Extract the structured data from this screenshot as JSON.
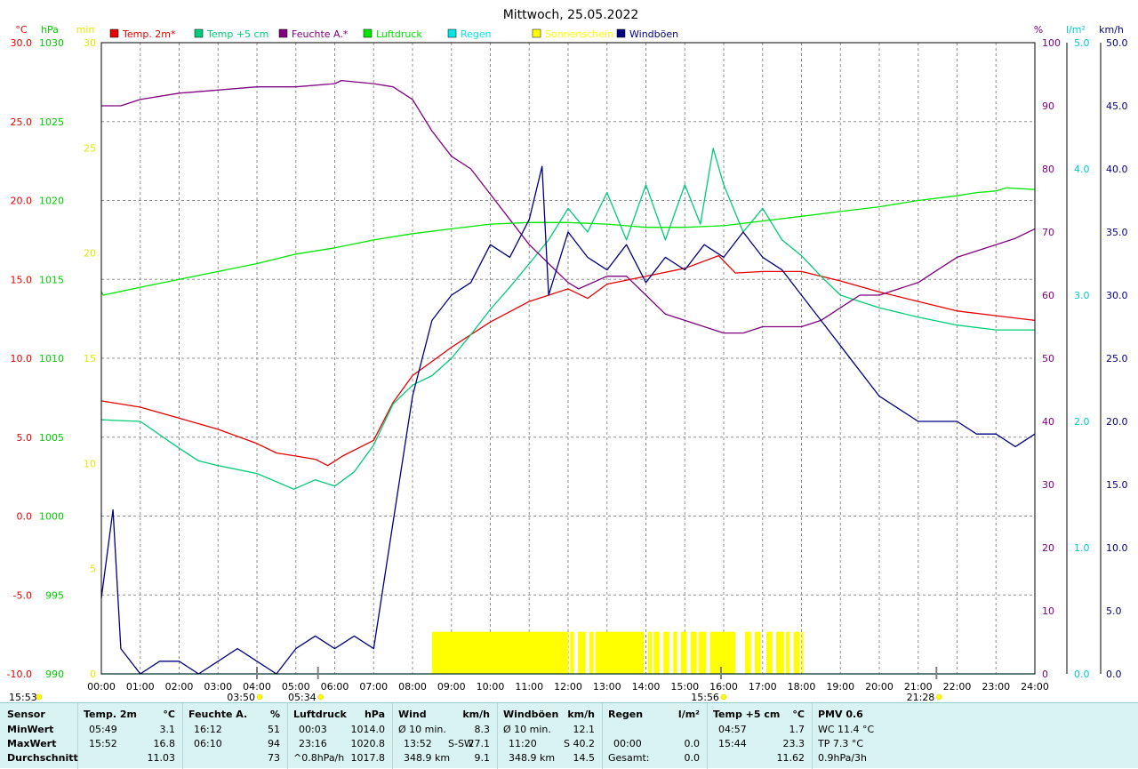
{
  "title": "Mittwoch, 25.05.2022",
  "colors": {
    "temp2m": "#e60000",
    "temp5cm": "#00cc77",
    "humidity": "#800080",
    "pressure": "#00e600",
    "rain": "#00e6e6",
    "sunshine": "#ffff00",
    "gusts": "#000080",
    "grid": "#808080"
  },
  "legend": [
    {
      "label": "Temp. 2m*",
      "color": "#e60000"
    },
    {
      "label": "Temp +5 cm",
      "color": "#00cc77"
    },
    {
      "label": "Feuchte A.*",
      "color": "#800080"
    },
    {
      "label": "Luftdruck",
      "color": "#00e600"
    },
    {
      "label": "Regen",
      "color": "#00e6e6"
    },
    {
      "label": "Sonnenschein",
      "color": "#ffff00"
    },
    {
      "label": "Windböen",
      "color": "#000080"
    }
  ],
  "axis_units": {
    "temp": "°C",
    "pressure": "hPa",
    "sun": "min",
    "humidity": "%",
    "rain": "l/m²",
    "wind": "km/h"
  },
  "chart_data": {
    "type": "line",
    "title": "Mittwoch, 25.05.2022",
    "x_ticks": [
      "00:00",
      "01:00",
      "02:00",
      "03:00",
      "04:00",
      "05:00",
      "06:00",
      "07:00",
      "08:00",
      "09:00",
      "10:00",
      "11:00",
      "12:00",
      "13:00",
      "14:00",
      "15:00",
      "16:00",
      "17:00",
      "18:00",
      "19:00",
      "20:00",
      "21:00",
      "22:00",
      "23:00",
      "24:00"
    ],
    "x_range_hours": [
      0,
      24
    ],
    "axes": {
      "temp_c": {
        "range": [
          -10,
          30
        ],
        "ticks": [
          "30.0",
          "25.0",
          "20.0",
          "15.0",
          "10.0",
          "5.0",
          "0.0",
          "-5.0",
          "-10.0"
        ]
      },
      "pressure_hpa": {
        "range": [
          990,
          1030
        ],
        "ticks": [
          "1030",
          "1025",
          "1020",
          "1015",
          "1010",
          "1005",
          "1000",
          "995",
          "990"
        ]
      },
      "sunshine_min": {
        "range": [
          0,
          30
        ],
        "ticks": [
          "30",
          "25",
          "20",
          "15",
          "10",
          "5",
          "0"
        ]
      },
      "humidity_pct": {
        "range": [
          0,
          100
        ],
        "ticks": [
          "100",
          "90",
          "80",
          "70",
          "60",
          "50",
          "40",
          "30",
          "20",
          "10",
          "0"
        ]
      },
      "rain_l": {
        "range": [
          0,
          5
        ],
        "ticks": [
          "5.0",
          "4.0",
          "3.0",
          "2.0",
          "1.0",
          "0.0"
        ]
      },
      "wind_kmh": {
        "range": [
          0,
          50
        ],
        "ticks": [
          "50.0",
          "45.0",
          "40.0",
          "35.0",
          "30.0",
          "25.0",
          "20.0",
          "15.0",
          "10.0",
          "5.0",
          "0.0"
        ]
      }
    },
    "grid": true,
    "legend_position": "top",
    "series": [
      {
        "name": "Temp. 2m*",
        "unit": "°C",
        "x": [
          0,
          1,
          2,
          3,
          4,
          4.5,
          5,
          5.5,
          5.82,
          6.2,
          7,
          7.5,
          8,
          9,
          10,
          11,
          12,
          12.5,
          13,
          14,
          15,
          15.87,
          16.3,
          17,
          18,
          19,
          20,
          21,
          22,
          23,
          24
        ],
        "y": [
          7.3,
          6.9,
          6.2,
          5.5,
          4.6,
          4.0,
          3.8,
          3.6,
          3.2,
          3.8,
          4.8,
          7.2,
          8.9,
          10.7,
          12.3,
          13.6,
          14.4,
          13.8,
          14.7,
          15.2,
          15.7,
          16.5,
          15.4,
          15.5,
          15.5,
          14.9,
          14.2,
          13.6,
          13.0,
          12.7,
          12.4
        ]
      },
      {
        "name": "Temp +5 cm",
        "unit": "°C",
        "x": [
          0,
          1,
          2,
          2.5,
          3,
          4,
          4.95,
          5.5,
          6,
          6.5,
          7,
          7.5,
          8,
          8.5,
          9,
          9.5,
          10,
          10.5,
          11,
          11.5,
          12,
          12.5,
          13,
          13.5,
          14,
          14.5,
          15,
          15.4,
          15.73,
          16,
          16.5,
          17,
          17.5,
          18,
          18.5,
          19,
          20,
          21,
          22,
          23,
          24
        ],
        "y": [
          6.1,
          6.0,
          4.3,
          3.5,
          3.2,
          2.7,
          1.7,
          2.3,
          1.9,
          2.8,
          4.5,
          7.1,
          8.3,
          8.9,
          10.0,
          11.5,
          13.1,
          14.5,
          16.0,
          17.5,
          19.5,
          18.0,
          20.5,
          17.5,
          21.0,
          17.5,
          21.0,
          18.5,
          23.3,
          21.0,
          18.0,
          19.5,
          17.5,
          16.5,
          15.2,
          14.0,
          13.2,
          12.6,
          12.1,
          11.8,
          11.8
        ]
      },
      {
        "name": "Feuchte A.*",
        "unit": "%",
        "x": [
          0,
          0.5,
          1,
          2,
          3,
          4,
          5,
          6,
          6.17,
          7,
          7.5,
          8,
          8.5,
          9,
          9.5,
          10,
          10.5,
          11,
          11.5,
          12,
          12.27,
          13,
          13.5,
          14,
          14.5,
          15,
          15.5,
          16,
          16.5,
          17,
          17.5,
          18,
          18.5,
          19,
          19.5,
          20,
          20.5,
          21,
          21.5,
          22,
          23,
          23.5,
          24
        ],
        "y": [
          90,
          90,
          91,
          92,
          92.5,
          93,
          93,
          93.5,
          94,
          93.5,
          93,
          91,
          86,
          82,
          80,
          76,
          72,
          68,
          65,
          62,
          61,
          63,
          63,
          60,
          57,
          56,
          55,
          54,
          54,
          55,
          55,
          55,
          56,
          58,
          60,
          60,
          61,
          62,
          64,
          66,
          68,
          69,
          70.5
        ]
      },
      {
        "name": "Luftdruck",
        "unit": "hPa",
        "x": [
          0,
          0.05,
          1,
          2,
          3,
          4,
          5,
          6,
          7,
          8,
          9,
          10,
          11,
          12,
          13,
          14,
          15,
          16,
          17,
          18,
          19,
          20,
          21,
          22,
          22.5,
          23,
          23.27,
          24
        ],
        "y": [
          1014.2,
          1014.0,
          1014.5,
          1015.0,
          1015.5,
          1016.0,
          1016.6,
          1017.0,
          1017.5,
          1017.9,
          1018.2,
          1018.5,
          1018.6,
          1018.6,
          1018.5,
          1018.3,
          1018.3,
          1018.4,
          1018.7,
          1019.0,
          1019.3,
          1019.6,
          1020.0,
          1020.3,
          1020.5,
          1020.6,
          1020.8,
          1020.7
        ]
      },
      {
        "name": "Regen",
        "unit": "l/m²",
        "x": [
          0,
          24
        ],
        "y": [
          0,
          0
        ]
      },
      {
        "name": "Windböen",
        "unit": "km/h",
        "x": [
          0,
          0.3,
          0.5,
          1,
          1.5,
          2,
          2.5,
          3,
          3.5,
          4,
          4.5,
          5,
          5.5,
          6,
          6.5,
          7,
          7.5,
          8,
          8.5,
          9,
          9.5,
          10,
          10.5,
          11,
          11.33,
          11.5,
          12,
          12.5,
          13,
          13.5,
          14,
          14.5,
          15,
          15.5,
          16,
          16.5,
          17,
          17.5,
          18,
          18.5,
          19,
          19.5,
          20,
          20.5,
          21,
          21.5,
          22,
          22.5,
          23,
          23.5,
          24
        ],
        "y": [
          6,
          13,
          2,
          0,
          1,
          1,
          0,
          1,
          2,
          1,
          0,
          2,
          3,
          2,
          3,
          2,
          12,
          22,
          28,
          30,
          31,
          34,
          33,
          36,
          40.2,
          30,
          35,
          33,
          32,
          34,
          31,
          33,
          32,
          34,
          33,
          35,
          33,
          32,
          30,
          28,
          26,
          24,
          22,
          21,
          20,
          20,
          20,
          19,
          19,
          18,
          19
        ]
      }
    ],
    "sunshine_intervals": [
      [
        8.5,
        12.0
      ],
      [
        12.05,
        12.15
      ],
      [
        12.25,
        12.45
      ],
      [
        12.55,
        12.65
      ],
      [
        12.7,
        13.95
      ],
      [
        14.05,
        14.15
      ],
      [
        14.2,
        14.35
      ],
      [
        14.45,
        14.6
      ],
      [
        14.7,
        14.8
      ],
      [
        14.9,
        15.05
      ],
      [
        15.15,
        15.3
      ],
      [
        15.35,
        15.55
      ],
      [
        15.65,
        16.3
      ],
      [
        16.55,
        16.7
      ],
      [
        16.8,
        16.95
      ],
      [
        17.1,
        17.25
      ],
      [
        17.35,
        17.55
      ],
      [
        17.6,
        17.7
      ],
      [
        17.8,
        17.95
      ],
      [
        18.0,
        18.05
      ]
    ],
    "sunshine_bar_min": 2,
    "markers": [
      {
        "label": "03:50",
        "x": 4.0
      },
      {
        "label": "05:34",
        "x": 5.57
      },
      {
        "label": "15:56",
        "x": 15.93
      },
      {
        "label": "21:28",
        "x": 21.47
      }
    ],
    "sun_marks": [
      {
        "label": "15:53",
        "position": "left"
      },
      {
        "label": "21:28",
        "position": "right"
      }
    ]
  },
  "stats": {
    "sensor": {
      "title": "Sensor",
      "rows": [
        "MinWert",
        "MaxWert",
        "Durchschnitt"
      ]
    },
    "temp2m": {
      "title": "Temp. 2m",
      "unit": "°C",
      "min_time": "05:49",
      "min": "3.1",
      "max_time": "15:52",
      "max": "16.8",
      "avg": "11.03"
    },
    "humidity": {
      "title": "Feuchte A.",
      "unit": "%",
      "min_time": "16:12",
      "min": "51",
      "max_time": "06:10",
      "max": "94",
      "avg": "73"
    },
    "pressure": {
      "title": "Luftdruck",
      "unit": "hPa",
      "min_time": "00:03",
      "min": "1014.0",
      "max_time": "23:16",
      "max": "1020.8",
      "avg_label": "^0.8hPa/h",
      "avg": "1017.8"
    },
    "wind": {
      "title": "Wind",
      "unit": "km/h",
      "r1_label": "Ø 10 min.",
      "r1_val": "8.3",
      "r2_time": "13:52",
      "r2_dir": "S-SW",
      "r2_val": "27.1",
      "r3_label": "348.9 km",
      "r3_val": "9.1"
    },
    "gusts": {
      "title": "Windböen",
      "unit": "km/h",
      "r1_label": "Ø 10 min.",
      "r1_val": "12.1",
      "r2_time": "11:20",
      "r2_dir": "S",
      "r2_val": "40.2",
      "r3_label": "348.9 km",
      "r3_val": "14.5"
    },
    "rain": {
      "title": "Regen",
      "unit": "l/m²",
      "r2_time": "00:00",
      "r2_val": "0.0",
      "r3_label": "Gesamt:",
      "r3_val": "0.0"
    },
    "temp5cm": {
      "title": "Temp +5 cm",
      "unit": "°C",
      "min_time": "04:57",
      "min": "1.7",
      "max_time": "15:44",
      "max": "23.3",
      "avg": "11.62"
    },
    "pmv": {
      "title": "PMV 0.6",
      "l1": "WC 11.4 °C",
      "l2": "TP 7.3 °C",
      "l3": "0.9hPa/3h"
    }
  }
}
